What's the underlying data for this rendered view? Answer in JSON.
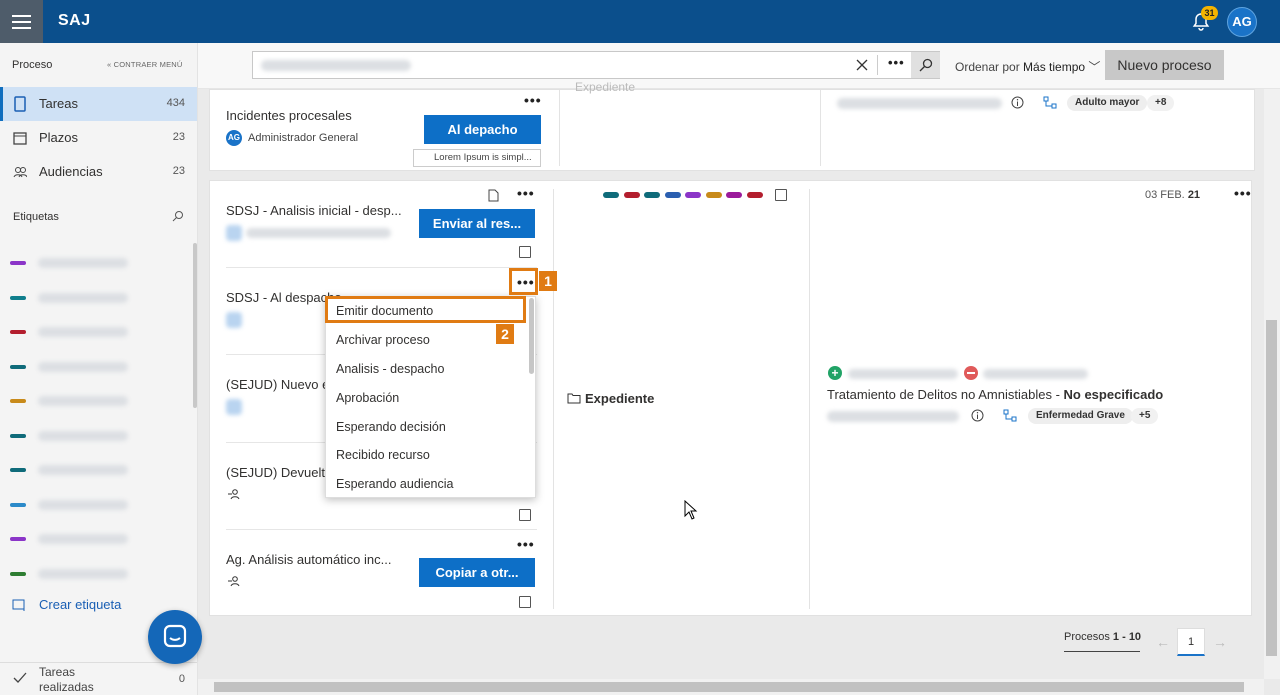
{
  "app": {
    "brand": "SAJ",
    "notifications_count": "31",
    "avatar_initials": "AG"
  },
  "sidebar": {
    "header": "Proceso",
    "collapse_label": "CONTRAER MENÚ",
    "items": [
      {
        "label": "Tareas",
        "count": "434",
        "icon": "tasks-icon"
      },
      {
        "label": "Plazos",
        "count": "23",
        "icon": "calendar-icon"
      },
      {
        "label": "Audiencias",
        "count": "23",
        "icon": "people-icon"
      }
    ],
    "tags_header": "Etiquetas",
    "tag_colors": [
      "#8b35c8",
      "#0f7e8c",
      "#b31e2e",
      "#0f6b7a",
      "#c88a1a",
      "#0f6b7a",
      "#0f6b7a",
      "#2b8ac9",
      "#8b35c8",
      "#2e7d32"
    ],
    "create_tag": "Crear etiqueta",
    "done_label": "Tareas realizadas",
    "done_count": "0"
  },
  "toolbar": {
    "order_prefix": "Ordenar por",
    "order_value": "Más tiempo",
    "new_process": "Nuevo proceso"
  },
  "top_card": {
    "title": "Incidentes procesales",
    "user_initials": "AG",
    "user": "Administrador General",
    "action": "Al depacho",
    "note": "Lorem Ipsum is simpl...",
    "expediente": "Expediente",
    "chip": "Adulto mayor",
    "chip_more": "+8"
  },
  "main_card": {
    "date_day": "03 FEB.",
    "date_year": "21",
    "tasks": [
      {
        "title": "SDSJ - Analisis inicial - desp...",
        "action": "Enviar al res..."
      },
      {
        "title": "SDSJ - Al despacho",
        "action": ""
      },
      {
        "title": "(SEJUD) Nuevo e",
        "action": ""
      },
      {
        "title": "(SEJUD) Devuelto",
        "action": ""
      },
      {
        "title": "Ag. Análisis automático inc...",
        "action": "Copiar a otr..."
      }
    ],
    "color_tags": [
      "#0f6b7a",
      "#b31e2e",
      "#0f6b7a",
      "#2b5fb0",
      "#8b35c8",
      "#c88a1a",
      "#9b1a9b",
      "#b31e2e"
    ],
    "expediente": "Expediente",
    "case_title": "Tratamiento de Delitos no Amnistiables - ",
    "case_status": "No especificado",
    "chip": "Enfermedad Grave",
    "chip_more": "+5"
  },
  "dropdown": {
    "items": [
      "Emitir documento",
      "Archivar proceso",
      "Analisis - despacho",
      "Aprobación",
      "Esperando decisión",
      "Recibido recurso",
      "Esperando audiencia"
    ]
  },
  "callouts": {
    "one": "1",
    "two": "2"
  },
  "pager": {
    "label": "Procesos",
    "range": "1 - 10",
    "page": "1"
  }
}
